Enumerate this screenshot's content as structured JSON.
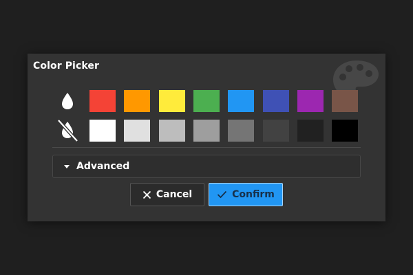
{
  "dialog": {
    "title": "Color Picker",
    "background_icon": "palette-icon"
  },
  "rows": [
    {
      "icon": "opacity-drop-icon",
      "swatches": [
        "#f44336",
        "#ff9800",
        "#ffeb3b",
        "#4caf50",
        "#2196f3",
        "#3f51b5",
        "#9c27b0",
        "#795548"
      ]
    },
    {
      "icon": "no-opacity-drop-icon",
      "swatches": [
        "#ffffff",
        "#e0e0e0",
        "#bdbdbd",
        "#9e9e9e",
        "#757575",
        "#424242",
        "#212121",
        "#000000"
      ]
    }
  ],
  "advanced": {
    "label": "Advanced",
    "icon": "caret-down-icon"
  },
  "buttons": {
    "cancel_label": "Cancel",
    "cancel_icon": "close-icon",
    "confirm_label": "Confirm",
    "confirm_icon": "check-icon"
  },
  "colors": {
    "dialog_bg": "#333333",
    "page_bg": "#1f1f1f",
    "accent": "#2196f3"
  }
}
